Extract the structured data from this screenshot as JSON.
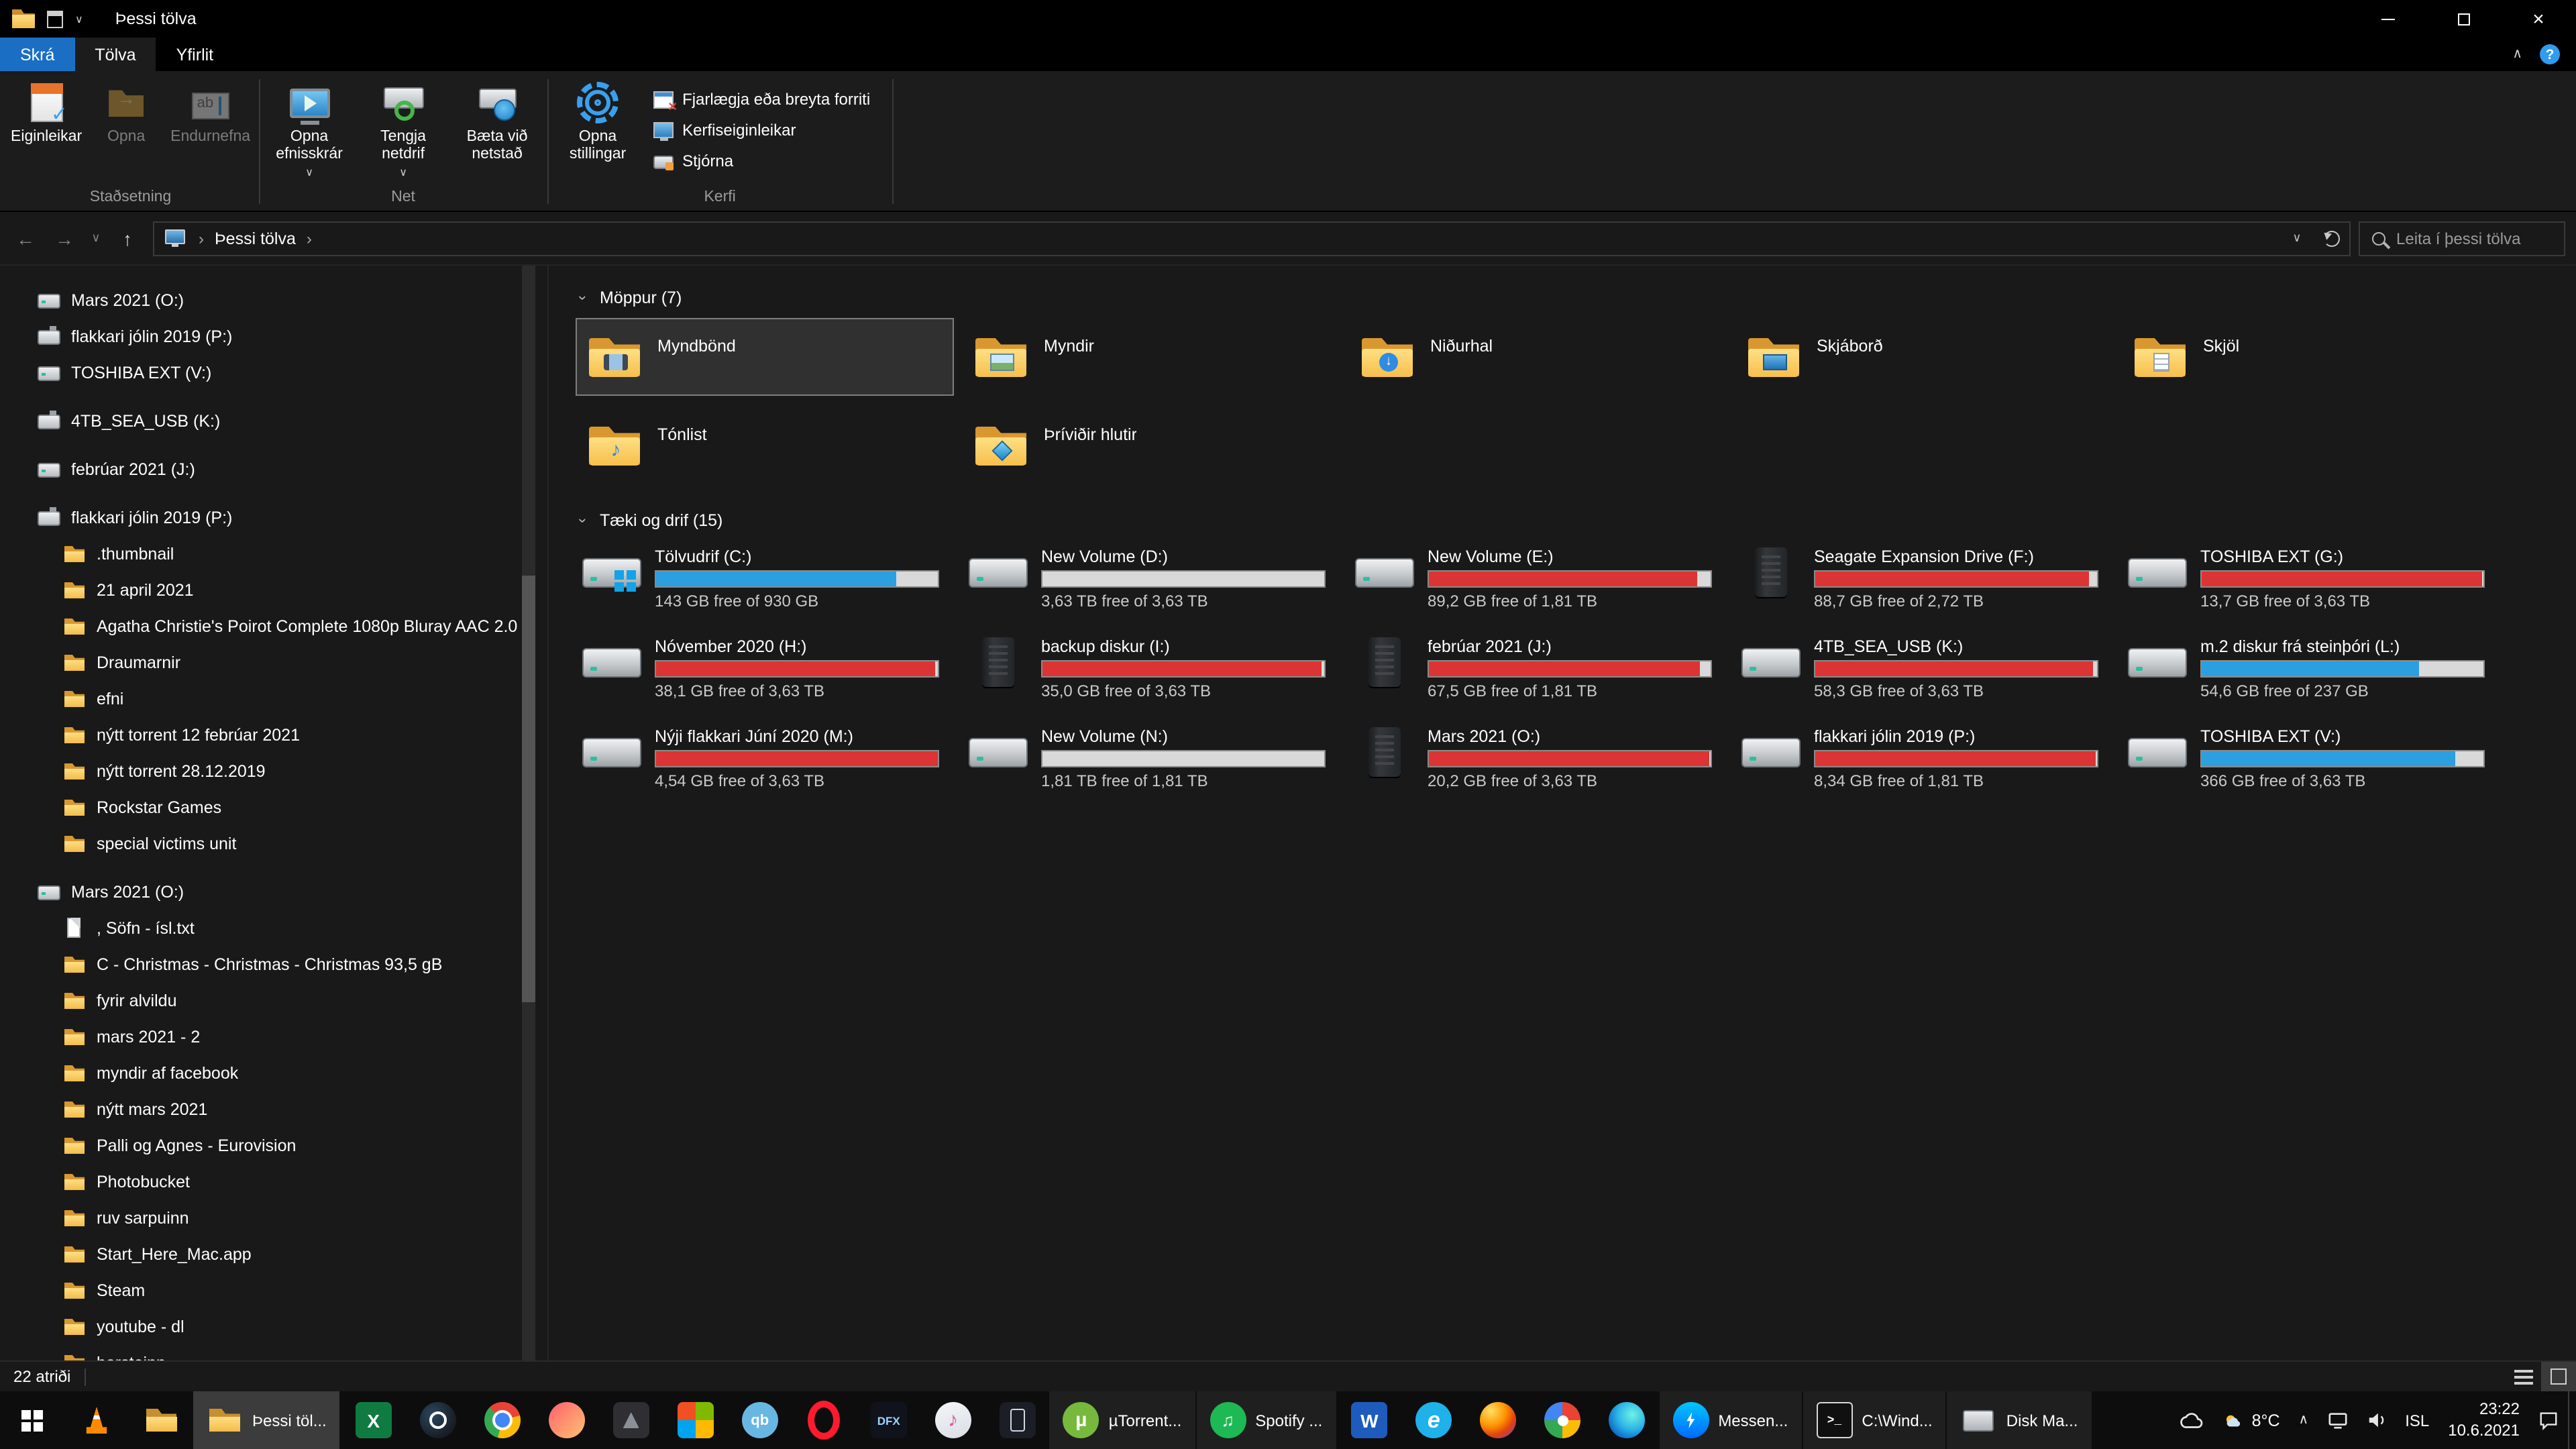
{
  "titlebar": {
    "title": "Þessi tölva"
  },
  "ribbon": {
    "tabs": [
      {
        "label": "Skrá",
        "type": "file",
        "dn": "tab-skra"
      },
      {
        "label": "Tölva",
        "type": "active",
        "dn": "tab-tolva"
      },
      {
        "label": "Yfirlit",
        "type": "normal",
        "dn": "tab-yfirlit"
      }
    ],
    "group1": {
      "label": "Staðsetning",
      "buttons": [
        {
          "label": "Eiginleikar",
          "icon": "properties",
          "dn": "properties-button"
        },
        {
          "label": "Opna",
          "icon": "open",
          "enabled": false,
          "dn": "open-button"
        },
        {
          "label": "Endurnefna",
          "icon": "rename",
          "enabled": false,
          "dn": "rename-button"
        }
      ]
    },
    "group2": {
      "label": "Net",
      "buttons": [
        {
          "label": "Opna efnisskrár",
          "icon": "media",
          "dropdown": true,
          "dn": "access-media-button"
        },
        {
          "label": "Tengja netdrif",
          "icon": "mapdrive",
          "dropdown": true,
          "dn": "map-network-drive-button"
        },
        {
          "label": "Bæta við netstað",
          "icon": "addnet",
          "dn": "add-network-location-button"
        }
      ]
    },
    "group3": {
      "label": "Kerfi",
      "buttons": [
        {
          "label": "Opna stillingar",
          "icon": "settings",
          "dn": "open-settings-button"
        }
      ],
      "links": [
        {
          "label": "Fjarlægja eða breyta forriti",
          "icon": "uninstall",
          "dn": "uninstall-program-link"
        },
        {
          "label": "Kerfiseiginleikar",
          "icon": "sysprops",
          "dn": "system-properties-link"
        },
        {
          "label": "Stjórna",
          "icon": "manage",
          "dn": "manage-link"
        }
      ]
    }
  },
  "navbar": {
    "breadcrumb": "Þessi tölva",
    "search_placeholder": "Leita í þessi tölva"
  },
  "sidebar": {
    "items": [
      {
        "label": "Mars 2021 (O:)",
        "icon": "drive",
        "level": 0
      },
      {
        "label": "flakkari jólin 2019 (P:)",
        "icon": "usb",
        "level": 0
      },
      {
        "label": "TOSHIBA EXT (V:)",
        "icon": "drive",
        "level": 0
      },
      {
        "label": "4TB_SEA_USB (K:)",
        "icon": "usb",
        "level": 0,
        "gap": true
      },
      {
        "label": "febrúar 2021 (J:)",
        "icon": "drive",
        "level": 0,
        "gap": true
      },
      {
        "label": "flakkari jólin 2019 (P:)",
        "icon": "usb",
        "level": 0,
        "gap": true
      },
      {
        "label": ".thumbnail",
        "icon": "folder",
        "level": 1
      },
      {
        "label": "21 april 2021",
        "icon": "folder",
        "level": 1
      },
      {
        "label": "Agatha Christie's Poirot Complete 1080p Bluray AAC 2.0",
        "icon": "folder",
        "level": 1
      },
      {
        "label": "Draumarnir",
        "icon": "folder",
        "level": 1
      },
      {
        "label": "efni",
        "icon": "folder",
        "level": 1
      },
      {
        "label": "nýtt torrent 12 febrúar 2021",
        "icon": "folder",
        "level": 1
      },
      {
        "label": "nýtt torrent 28.12.2019",
        "icon": "folder",
        "level": 1
      },
      {
        "label": "Rockstar Games",
        "icon": "folder",
        "level": 1
      },
      {
        "label": "special victims unit",
        "icon": "folder",
        "level": 1
      },
      {
        "label": "Mars 2021 (O:)",
        "icon": "drive",
        "level": 0,
        "gap": true
      },
      {
        "label": ", Söfn - ísl.txt",
        "icon": "file",
        "level": 1
      },
      {
        "label": "C - Christmas - Christmas - Christmas 93,5 gB",
        "icon": "folder",
        "level": 1
      },
      {
        "label": "fyrir alvildu",
        "icon": "folder",
        "level": 1
      },
      {
        "label": "mars 2021 - 2",
        "icon": "folder",
        "level": 1
      },
      {
        "label": "myndir af facebook",
        "icon": "folder",
        "level": 1
      },
      {
        "label": "nýtt mars 2021",
        "icon": "folder",
        "level": 1
      },
      {
        "label": "Palli og Agnes - Eurovision",
        "icon": "folder",
        "level": 1
      },
      {
        "label": "Photobucket",
        "icon": "folder",
        "level": 1
      },
      {
        "label": "ruv sarpuinn",
        "icon": "folder",
        "level": 1
      },
      {
        "label": "Start_Here_Mac.app",
        "icon": "folder",
        "level": 1
      },
      {
        "label": "Steam",
        "icon": "folder",
        "level": 1
      },
      {
        "label": "youtube - dl",
        "icon": "folder",
        "level": 1
      },
      {
        "label": "þorsteinn",
        "icon": "folder",
        "level": 1
      }
    ]
  },
  "folders_section": {
    "title": "Möppur (7)",
    "items": [
      {
        "label": "Myndbönd",
        "badge": "videos",
        "selected": true,
        "dn": "folder-tile-myndbond"
      },
      {
        "label": "Myndir",
        "badge": "pictures",
        "dn": "folder-tile-myndir"
      },
      {
        "label": "Niðurhal",
        "badge": "downloads",
        "dn": "folder-tile-nidurhal"
      },
      {
        "label": "Skjáborð",
        "badge": "desktop",
        "dn": "folder-tile-skjabord"
      },
      {
        "label": "Skjöl",
        "badge": "documents",
        "dn": "folder-tile-skjol"
      },
      {
        "label": "Tónlist",
        "badge": "music",
        "dn": "folder-tile-tonlist"
      },
      {
        "label": "Þríviðir hlutir",
        "badge": "3d",
        "dn": "folder-tile-thrividir-hlutir"
      }
    ]
  },
  "drives_section": {
    "title": "Tæki og drif (15)",
    "items": [
      {
        "label": "Tölvudrif (C:)",
        "free": "143 GB free of 930 GB",
        "used_pct": 85,
        "bar": "blue",
        "icon": "drive-windows",
        "dn": "drive-tile-c"
      },
      {
        "label": "New Volume (D:)",
        "free": "3,63 TB free of 3,63 TB",
        "used_pct": 0,
        "bar": "blue",
        "icon": "drive",
        "dn": "drive-tile-d"
      },
      {
        "label": "New Volume (E:)",
        "free": "89,2 GB free of 1,81 TB",
        "used_pct": 95,
        "bar": "red",
        "icon": "drive",
        "dn": "drive-tile-e"
      },
      {
        "label": "Seagate Expansion Drive (F:)",
        "free": "88,7 GB free of 2,72 TB",
        "used_pct": 97,
        "bar": "red",
        "icon": "drive-dark",
        "dn": "drive-tile-f"
      },
      {
        "label": "TOSHIBA EXT (G:)",
        "free": "13,7 GB free of 3,63 TB",
        "used_pct": 99.6,
        "bar": "red",
        "icon": "drive",
        "dn": "drive-tile-g"
      },
      {
        "label": "Nóvember 2020 (H:)",
        "free": "38,1 GB free of 3,63 TB",
        "used_pct": 99,
        "bar": "red",
        "icon": "drive",
        "dn": "drive-tile-h"
      },
      {
        "label": "backup diskur (I:)",
        "free": "35,0 GB free of 3,63 TB",
        "used_pct": 99.1,
        "bar": "red",
        "icon": "drive-dark",
        "dn": "drive-tile-i"
      },
      {
        "label": "febrúar 2021 (J:)",
        "free": "67,5 GB free of 1,81 TB",
        "used_pct": 96.4,
        "bar": "red",
        "icon": "drive-dark",
        "dn": "drive-tile-j"
      },
      {
        "label": "4TB_SEA_USB (K:)",
        "free": "58,3 GB free of 3,63 TB",
        "used_pct": 98.4,
        "bar": "red",
        "icon": "drive",
        "dn": "drive-tile-k"
      },
      {
        "label": "m.2 diskur frá steinþóri (L:)",
        "free": "54,6 GB free of 237 GB",
        "used_pct": 77,
        "bar": "blue",
        "icon": "drive",
        "dn": "drive-tile-l"
      },
      {
        "label": "Nýji flakkari Júní 2020 (M:)",
        "free": "4,54 GB free of 3,63 TB",
        "used_pct": 99.9,
        "bar": "red",
        "icon": "drive",
        "dn": "drive-tile-m"
      },
      {
        "label": "New Volume (N:)",
        "free": "1,81 TB free of 1,81 TB",
        "used_pct": 0,
        "bar": "blue",
        "icon": "drive",
        "dn": "drive-tile-n"
      },
      {
        "label": "Mars 2021 (O:)",
        "free": "20,2 GB free of 3,63 TB",
        "used_pct": 99.5,
        "bar": "red",
        "icon": "drive-dark",
        "dn": "drive-tile-o"
      },
      {
        "label": "flakkari jólin 2019 (P:)",
        "free": "8,34 GB free of 1,81 TB",
        "used_pct": 99.5,
        "bar": "red",
        "icon": "drive",
        "dn": "drive-tile-p"
      },
      {
        "label": "TOSHIBA EXT (V:)",
        "free": "366 GB free of 3,63 TB",
        "used_pct": 90,
        "bar": "blue",
        "icon": "drive",
        "dn": "drive-tile-v"
      }
    ]
  },
  "statusbar": {
    "item_count": "22 atriði"
  },
  "taskbar": {
    "items": [
      {
        "dn": "taskbar-vlc",
        "app": "vlc"
      },
      {
        "dn": "taskbar-explorer",
        "app": "explorer"
      },
      {
        "dn": "taskbar-window-explorer",
        "app": "explorer",
        "kind": "task",
        "label": "Þessi töl...",
        "active": true
      },
      {
        "dn": "taskbar-excel",
        "app": "excel"
      },
      {
        "dn": "taskbar-steam",
        "app": "steam"
      },
      {
        "dn": "taskbar-chrome",
        "app": "chrome"
      },
      {
        "dn": "taskbar-photos",
        "app": "photos"
      },
      {
        "dn": "taskbar-dark-app",
        "app": "darkapp"
      },
      {
        "dn": "taskbar-tiles-app",
        "app": "mosaic"
      },
      {
        "dn": "taskbar-qbittorrent",
        "app": "qbit"
      },
      {
        "dn": "taskbar-opera",
        "app": "opera"
      },
      {
        "dn": "taskbar-dfx",
        "app": "dfx"
      },
      {
        "dn": "taskbar-itunes",
        "app": "itunes"
      },
      {
        "dn": "taskbar-your-phone",
        "app": "phone"
      },
      {
        "dn": "taskbar-window-utorrent",
        "app": "utorrent",
        "kind": "task",
        "label": "µTorrent..."
      },
      {
        "dn": "taskbar-window-spotify",
        "app": "spotify",
        "kind": "task",
        "label": "Spotify ..."
      },
      {
        "dn": "taskbar-word",
        "app": "word"
      },
      {
        "dn": "taskbar-internet-explorer",
        "app": "ie"
      },
      {
        "dn": "taskbar-firefox",
        "app": "firefox"
      },
      {
        "dn": "taskbar-pinwheel-app",
        "app": "pinwheel"
      },
      {
        "dn": "taskbar-edge",
        "app": "edge"
      },
      {
        "dn": "taskbar-window-messenger",
        "app": "messenger",
        "kind": "task",
        "label": "Messen..."
      },
      {
        "dn": "taskbar-window-cmd",
        "app": "cmd",
        "kind": "task",
        "label": "C:\\Wind..."
      },
      {
        "dn": "taskbar-window-diskmgmt",
        "app": "diskmgmt",
        "kind": "task",
        "label": "Disk Ma..."
      }
    ],
    "tray": {
      "weather_temp": "8°C",
      "language": "ISL",
      "time": "23:22",
      "date": "10.6.2021"
    }
  }
}
